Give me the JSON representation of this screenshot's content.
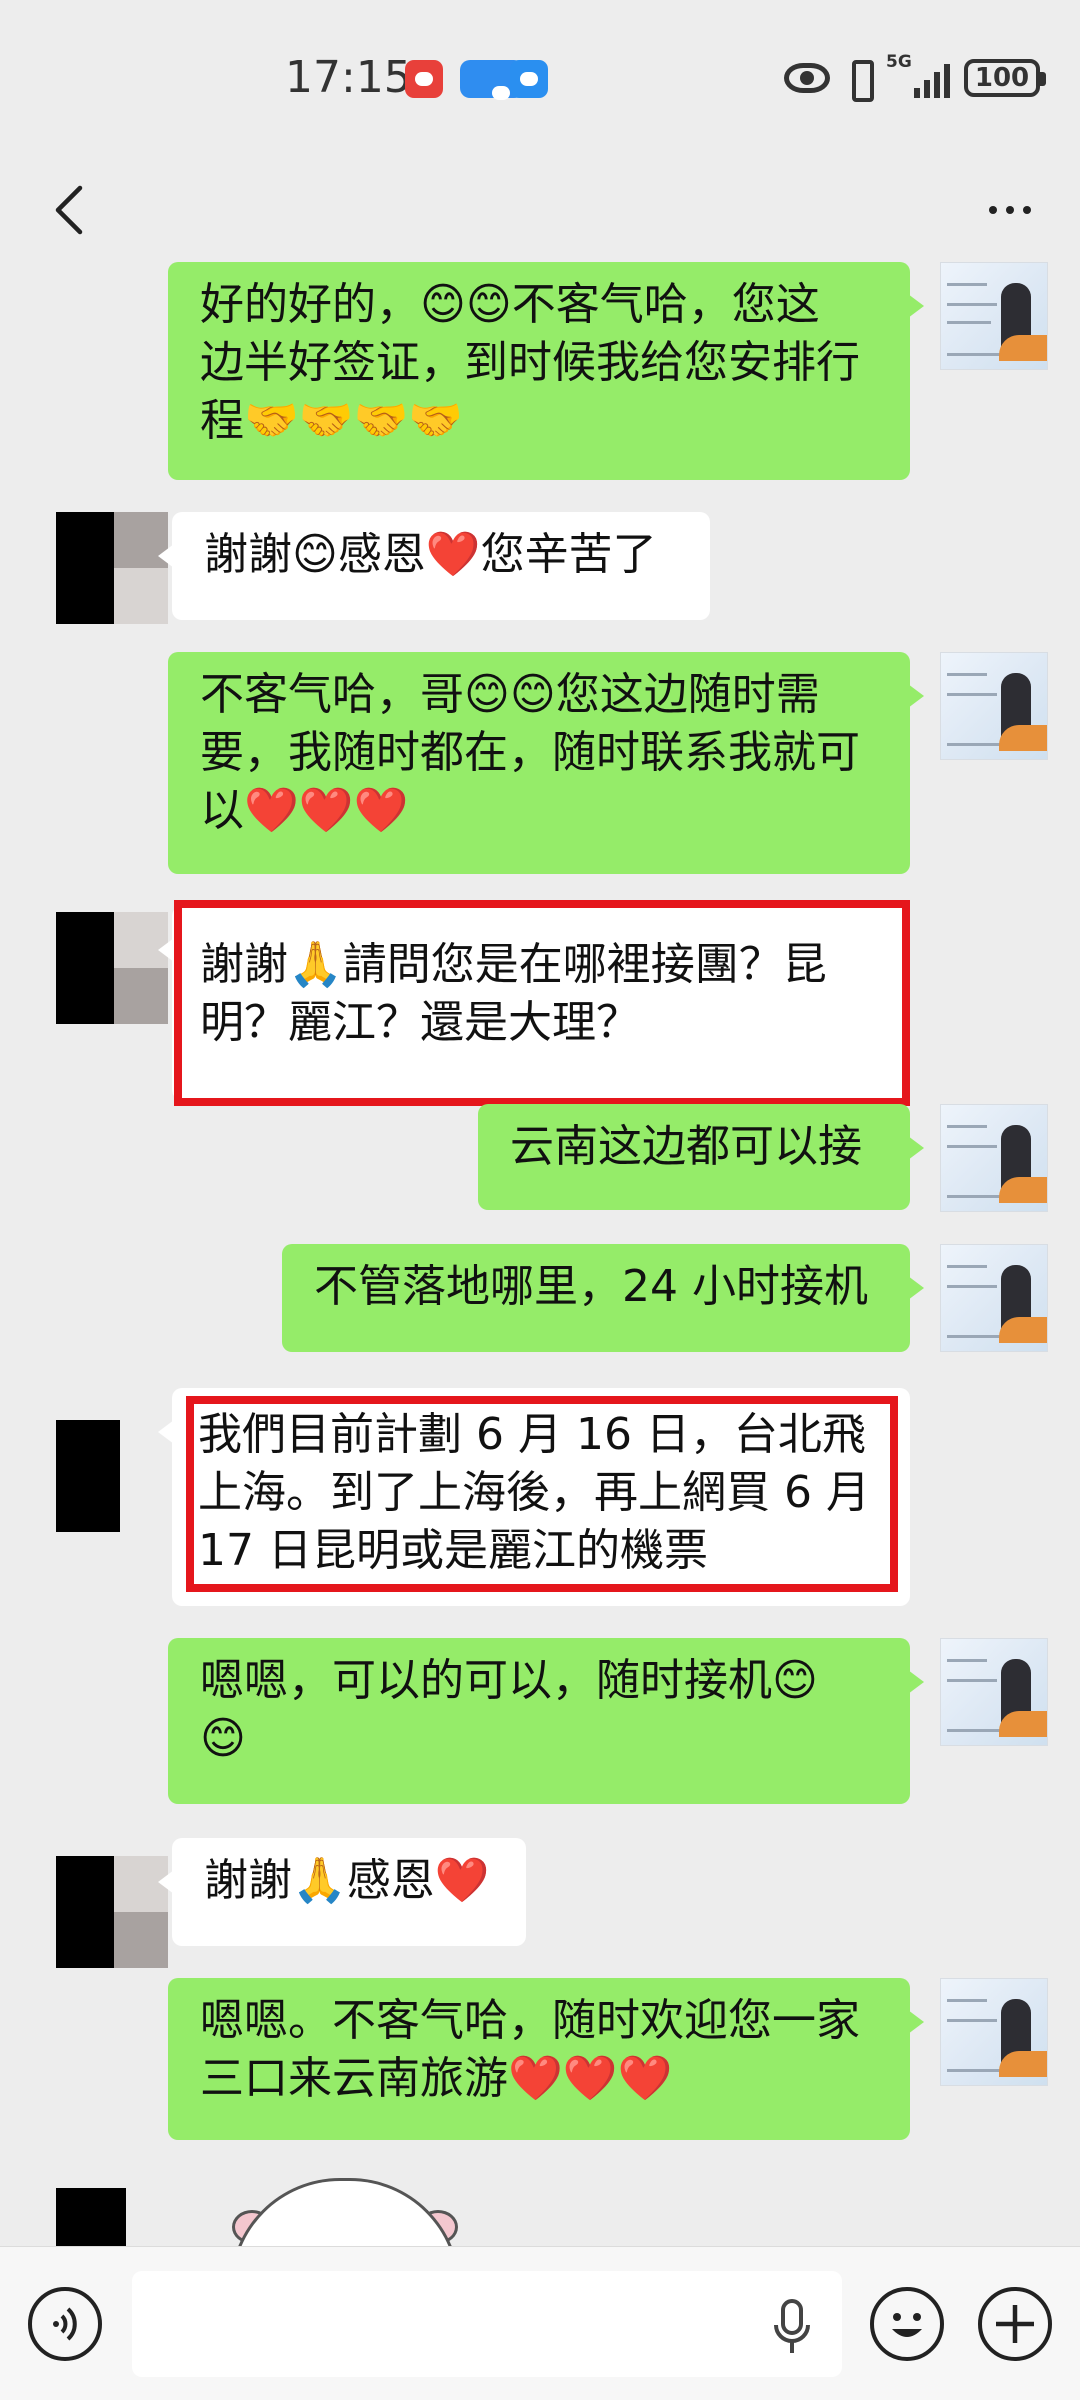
{
  "status_bar": {
    "time": "17:15",
    "network": "5G",
    "battery": "100",
    "app_icons": [
      "huawei-app-icon",
      "message-app-icon",
      "weather-app-icon"
    ]
  },
  "header": {
    "back_icon": "chevron-left-icon",
    "more_icon": "more-dots-icon"
  },
  "messages": [
    {
      "direction": "out",
      "lines": [
        "好的好的，😊😊不客气哈，您这",
        "边半好签证，到时候我给您安排行",
        "程🤝🤝🤝🤝"
      ]
    },
    {
      "direction": "in",
      "lines": [
        "謝謝😊感恩❤️您辛苦了"
      ]
    },
    {
      "direction": "out",
      "lines": [
        "不客气哈，哥😊😊您这边随时需",
        "要，我随时都在，随时联系我就可",
        "以❤️❤️❤️"
      ]
    },
    {
      "direction": "in",
      "highlighted": true,
      "lines": [
        "謝謝🙏請問您是在哪裡接團？昆",
        "明？麗江？還是大理？"
      ]
    },
    {
      "direction": "out",
      "lines": [
        "云南这边都可以接"
      ]
    },
    {
      "direction": "out",
      "lines": [
        "不管落地哪里，24 小时接机"
      ]
    },
    {
      "direction": "in",
      "highlighted": true,
      "lines": [
        "我們目前計劃 6 月 16 日，台北飛",
        "上海。到了上海後，再上網買 6 月",
        "17 日昆明或是麗江的機票"
      ]
    },
    {
      "direction": "out",
      "lines": [
        "嗯嗯，可以的可以，随时接机😊",
        "😊"
      ]
    },
    {
      "direction": "in",
      "lines": [
        "謝謝🙏感恩❤️"
      ]
    },
    {
      "direction": "out",
      "lines": [
        "嗯嗯。不客气哈，随时欢迎您一家",
        "三口来云南旅游❤️❤️❤️"
      ]
    }
  ],
  "input_bar": {
    "voice_icon": "voice-wave-icon",
    "mic_icon": "microphone-icon",
    "emoji_icon": "smiley-icon",
    "plus_icon": "plus-icon",
    "text_value": ""
  },
  "colors": {
    "outgoing_bubble": "#95ec69",
    "incoming_bubble": "#ffffff",
    "background": "#ededed",
    "highlight": "#e5161c"
  }
}
